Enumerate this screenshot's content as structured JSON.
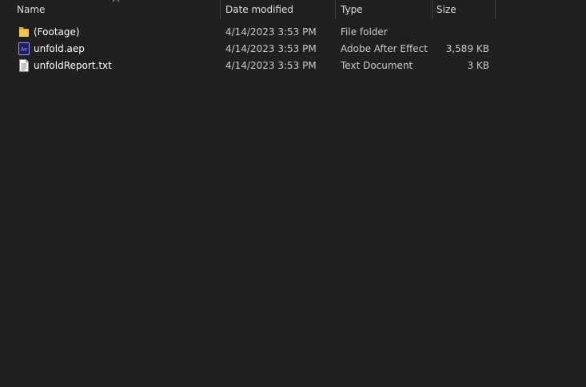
{
  "columns": {
    "name": "Name",
    "date_modified": "Date modified",
    "type": "Type",
    "size": "Size"
  },
  "sort": {
    "column": "name",
    "icon": "sort-ascending-icon"
  },
  "files": [
    {
      "name": "(Footage)",
      "date_modified": "4/14/2023 3:53 PM",
      "type": "File folder",
      "size": "",
      "icon": "folder-icon"
    },
    {
      "name": "unfold.aep",
      "date_modified": "4/14/2023 3:53 PM",
      "type": "Adobe After Effect...",
      "size": "3,589 KB",
      "icon": "after-effects-file-icon"
    },
    {
      "name": "unfoldReport.txt",
      "date_modified": "4/14/2023 3:53 PM",
      "type": "Text Document",
      "size": "3 KB",
      "icon": "text-document-icon"
    }
  ],
  "colors": {
    "background": "#202020",
    "header_text": "#dedede",
    "row_text": "#c9c9c9",
    "separator": "#3b3b3b",
    "folder": "#f0c04a",
    "ae_purple": "#9999ff",
    "ae_dark": "#00005b"
  }
}
